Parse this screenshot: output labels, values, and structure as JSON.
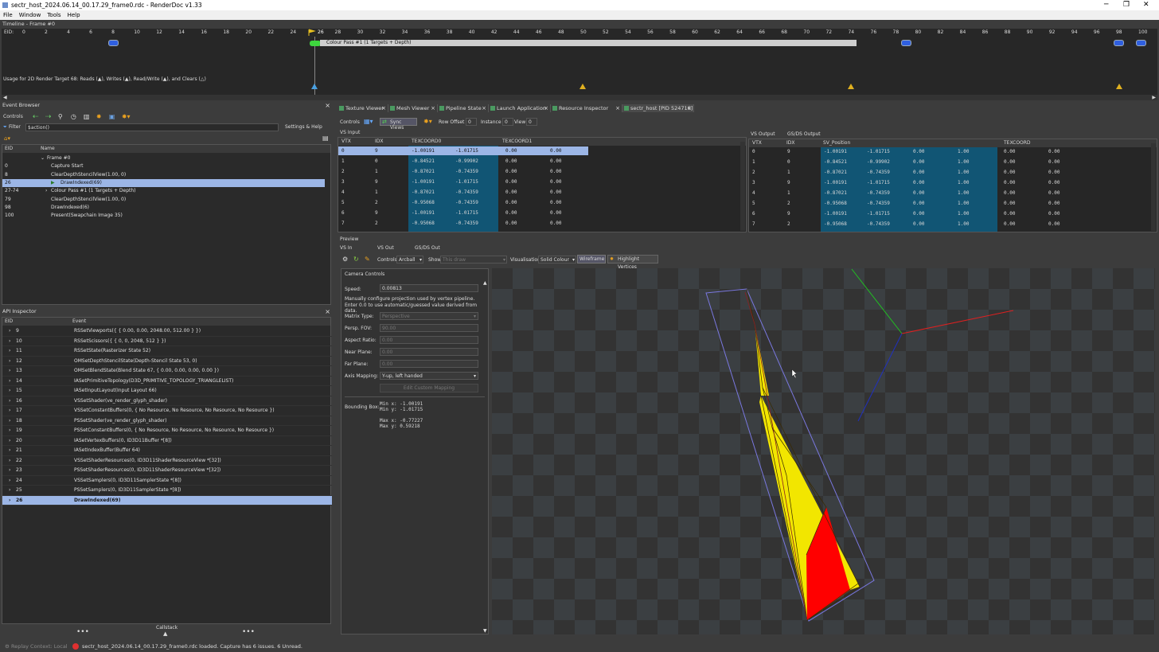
{
  "window": {
    "title": "sectr_host_2024.06.14_00.17.29_frame0.rdc - RenderDoc v1.33",
    "controls": [
      "─",
      "❐",
      "✕"
    ]
  },
  "menu": [
    "File",
    "Window",
    "Tools",
    "Help"
  ],
  "timeline": {
    "title": "Timeline - Frame #0",
    "eid_label": "EID:",
    "ticks": [
      "0",
      "2",
      "4",
      "6",
      "8",
      "10",
      "12",
      "14",
      "16",
      "18",
      "20",
      "22",
      "24",
      "26",
      "28",
      "30",
      "32",
      "34",
      "36",
      "38",
      "40",
      "42",
      "44",
      "46",
      "48",
      "50",
      "52",
      "54",
      "56",
      "58",
      "60",
      "62",
      "64",
      "66",
      "68",
      "70",
      "72",
      "74",
      "76",
      "78",
      "80",
      "82",
      "84",
      "86",
      "88",
      "90",
      "92",
      "94",
      "96",
      "98",
      "100"
    ],
    "current_eid": "26",
    "pass_label": "Colour Pass #1 (1 Targets + Depth)",
    "usage_text": "Usage for 2D Render Target 68: Reads (▲), Writes (▲), Read/Write (▲), and Clears (△)"
  },
  "event_browser": {
    "title": "Event Browser",
    "controls_label": "Controls",
    "filter_label": "Filter",
    "filter_value": "$action()",
    "settings_label": "Settings & Help",
    "col_eid": "EID",
    "col_name": "Name",
    "rows": [
      {
        "eid": "",
        "name": "Frame #0",
        "indent": 1,
        "exp": "⌄"
      },
      {
        "eid": "0",
        "name": "Capture Start",
        "indent": 2,
        "exp": ""
      },
      {
        "eid": "8",
        "name": "ClearDepthStencilView(1.00, 0)",
        "indent": 2,
        "exp": ""
      },
      {
        "eid": "26",
        "name": "DrawIndexed(69)",
        "indent": 2,
        "exp": "",
        "selected": true
      },
      {
        "eid": "27-74",
        "name": "Colour Pass #1 (1 Targets + Depth)",
        "indent": 2,
        "exp": "›"
      },
      {
        "eid": "79",
        "name": "ClearDepthStencilView(1.00, 0)",
        "indent": 2,
        "exp": ""
      },
      {
        "eid": "98",
        "name": "DrawIndexed(6)",
        "indent": 2,
        "exp": ""
      },
      {
        "eid": "100",
        "name": "Present(Swapchain Image 35)",
        "indent": 2,
        "exp": ""
      }
    ]
  },
  "api_inspector": {
    "title": "API Inspector",
    "col_eid": "EID",
    "col_event": "Event",
    "rows": [
      {
        "eid": "9",
        "event": "RSSetViewports({ { 0.00, 0.00, 2048.00, 512.00 } })"
      },
      {
        "eid": "10",
        "event": "RSSetScissors({ { 0, 0, 2048, 512 } })"
      },
      {
        "eid": "11",
        "event": "RSSetState(Rasterizer State 52)"
      },
      {
        "eid": "12",
        "event": "OMSetDepthStencilState(Depth-Stencil State 53, 0)"
      },
      {
        "eid": "13",
        "event": "OMSetBlendState(Blend State 67, { 0.00, 0.00, 0.00, 0.00 })"
      },
      {
        "eid": "14",
        "event": "IASetPrimitiveTopology(D3D_PRIMITIVE_TOPOLOGY_TRIANGLELIST)"
      },
      {
        "eid": "15",
        "event": "IASetInputLayout(Input Layout 66)"
      },
      {
        "eid": "16",
        "event": "VSSetShader(ve_render_glyph_shader)"
      },
      {
        "eid": "17",
        "event": "VSSetConstantBuffers(0, { No Resource, No Resource, No Resource, No Resource })"
      },
      {
        "eid": "18",
        "event": "PSSetShader(ve_render_glyph_shader)"
      },
      {
        "eid": "19",
        "event": "PSSetConstantBuffers(0, { No Resource, No Resource, No Resource, No Resource })"
      },
      {
        "eid": "20",
        "event": "IASetVertexBuffers(0, ID3D11Buffer *[8])"
      },
      {
        "eid": "21",
        "event": "IASetIndexBuffer(Buffer 64)"
      },
      {
        "eid": "22",
        "event": "VSSetShaderResources(0, ID3D11ShaderResourceView *[32])"
      },
      {
        "eid": "23",
        "event": "PSSetShaderResources(0, ID3D11ShaderResourceView *[32])"
      },
      {
        "eid": "24",
        "event": "VSSetSamplers(0, ID3D11SamplerState *[8])"
      },
      {
        "eid": "25",
        "event": "PSSetSamplers(0, ID3D11SamplerState *[8])"
      },
      {
        "eid": "26",
        "event": "DrawIndexed(69)",
        "selected": true
      }
    ],
    "callstack_label": "Callstack",
    "dots": "•••"
  },
  "tabs": [
    {
      "label": "Texture Viewer"
    },
    {
      "label": "Mesh Viewer"
    },
    {
      "label": "Pipeline State"
    },
    {
      "label": "Launch Application"
    },
    {
      "label": "Resource Inspector"
    },
    {
      "label": "sectr_host [PID 524716]"
    }
  ],
  "mesh_toolbar": {
    "controls_label": "Controls",
    "sync_views": "Sync Views",
    "row_offset_label": "Row Offset",
    "row_offset": "0",
    "instance_label": "Instance",
    "instance": "0",
    "view_label": "View",
    "view": "0"
  },
  "vs_input": {
    "title": "VS Input",
    "headers": [
      "VTX",
      "IDX",
      "TEXCOORD0",
      "TEXCOORD1"
    ],
    "rows": [
      [
        "0",
        "9",
        "-1.00191",
        "-1.01715",
        "0.00",
        "0.00"
      ],
      [
        "1",
        "0",
        "-0.84521",
        "-0.99902",
        "0.00",
        "0.00"
      ],
      [
        "2",
        "1",
        "-0.87021",
        "-0.74359",
        "0.00",
        "0.00"
      ],
      [
        "3",
        "9",
        "-1.00191",
        "-1.01715",
        "0.00",
        "0.00"
      ],
      [
        "4",
        "1",
        "-0.87021",
        "-0.74359",
        "0.00",
        "0.00"
      ],
      [
        "5",
        "2",
        "-0.95068",
        "-0.74359",
        "0.00",
        "0.00"
      ],
      [
        "6",
        "9",
        "-1.00191",
        "-1.01715",
        "0.00",
        "0.00"
      ],
      [
        "7",
        "2",
        "-0.95068",
        "-0.74359",
        "0.00",
        "0.00"
      ]
    ]
  },
  "vs_output": {
    "tab1": "VS Output",
    "tab2": "GS/DS Output",
    "headers": [
      "VTX",
      "IDX",
      "SV_Position",
      "TEXCOORD"
    ],
    "rows": [
      [
        "0",
        "9",
        "-1.00191",
        "-1.01715",
        "0.00",
        "1.00",
        "0.00",
        "0.00"
      ],
      [
        "1",
        "0",
        "-0.84521",
        "-0.99902",
        "0.00",
        "1.00",
        "0.00",
        "0.00"
      ],
      [
        "2",
        "1",
        "-0.87021",
        "-0.74359",
        "0.00",
        "1.00",
        "0.00",
        "0.00"
      ],
      [
        "3",
        "9",
        "-1.00191",
        "-1.01715",
        "0.00",
        "1.00",
        "0.00",
        "0.00"
      ],
      [
        "4",
        "1",
        "-0.87021",
        "-0.74359",
        "0.00",
        "1.00",
        "0.00",
        "0.00"
      ],
      [
        "5",
        "2",
        "-0.95068",
        "-0.74359",
        "0.00",
        "1.00",
        "0.00",
        "0.00"
      ],
      [
        "6",
        "9",
        "-1.00191",
        "-1.01715",
        "0.00",
        "1.00",
        "0.00",
        "0.00"
      ],
      [
        "7",
        "2",
        "-0.95068",
        "-0.74359",
        "0.00",
        "1.00",
        "0.00",
        "0.00"
      ]
    ]
  },
  "preview": {
    "title": "Preview",
    "tabs": [
      "VS In",
      "VS Out",
      "GS/DS Out"
    ],
    "controls_label": "Controls",
    "controls_value": "Arcball",
    "show_label": "Show",
    "show_value": "This draw",
    "visualisation_label": "Visualisation",
    "visualisation_value": "Solid Colour",
    "wireframe": "Wireframe",
    "highlight": "Highlight Vertices"
  },
  "camera": {
    "title": "Camera Controls",
    "speed_label": "Speed:",
    "speed": "0.00813",
    "note1": "Manually configure projection used by vertex pipeline.",
    "note2": "Enter 0.0 to use automatic/guessed value derived from data.",
    "matrix_label": "Matrix Type:",
    "matrix": "Perspective",
    "fov_label": "Persp. FOV:",
    "fov": "90.00",
    "aspect_label": "Aspect Ratio:",
    "aspect": "0.00",
    "near_label": "Near Plane:",
    "near": "0.00",
    "far_label": "Far Plane:",
    "far": "0.00",
    "axis_label": "Axis Mapping:",
    "axis": "Y-up, left handed",
    "edit_custom": "Edit Custom Mapping",
    "bbox_label": "Bounding Box:",
    "bbox_lines": [
      "Min x: -1.00191",
      "Min y: -1.01715",
      "",
      "Max x: -0.77227",
      "Max y: 0.59218"
    ]
  },
  "status": {
    "replay": "Replay Context: Local",
    "message": "sectr_host_2024.06.14_00.17.29_frame0.rdc loaded. Capture has 6 issues. 6 Unread."
  },
  "colors": {
    "selection": "#9cb6e6",
    "cell_blue": "#115574",
    "marker": "#2f5fe0",
    "mesh_yellow": "#f2e600",
    "mesh_red": "#ff0000"
  }
}
